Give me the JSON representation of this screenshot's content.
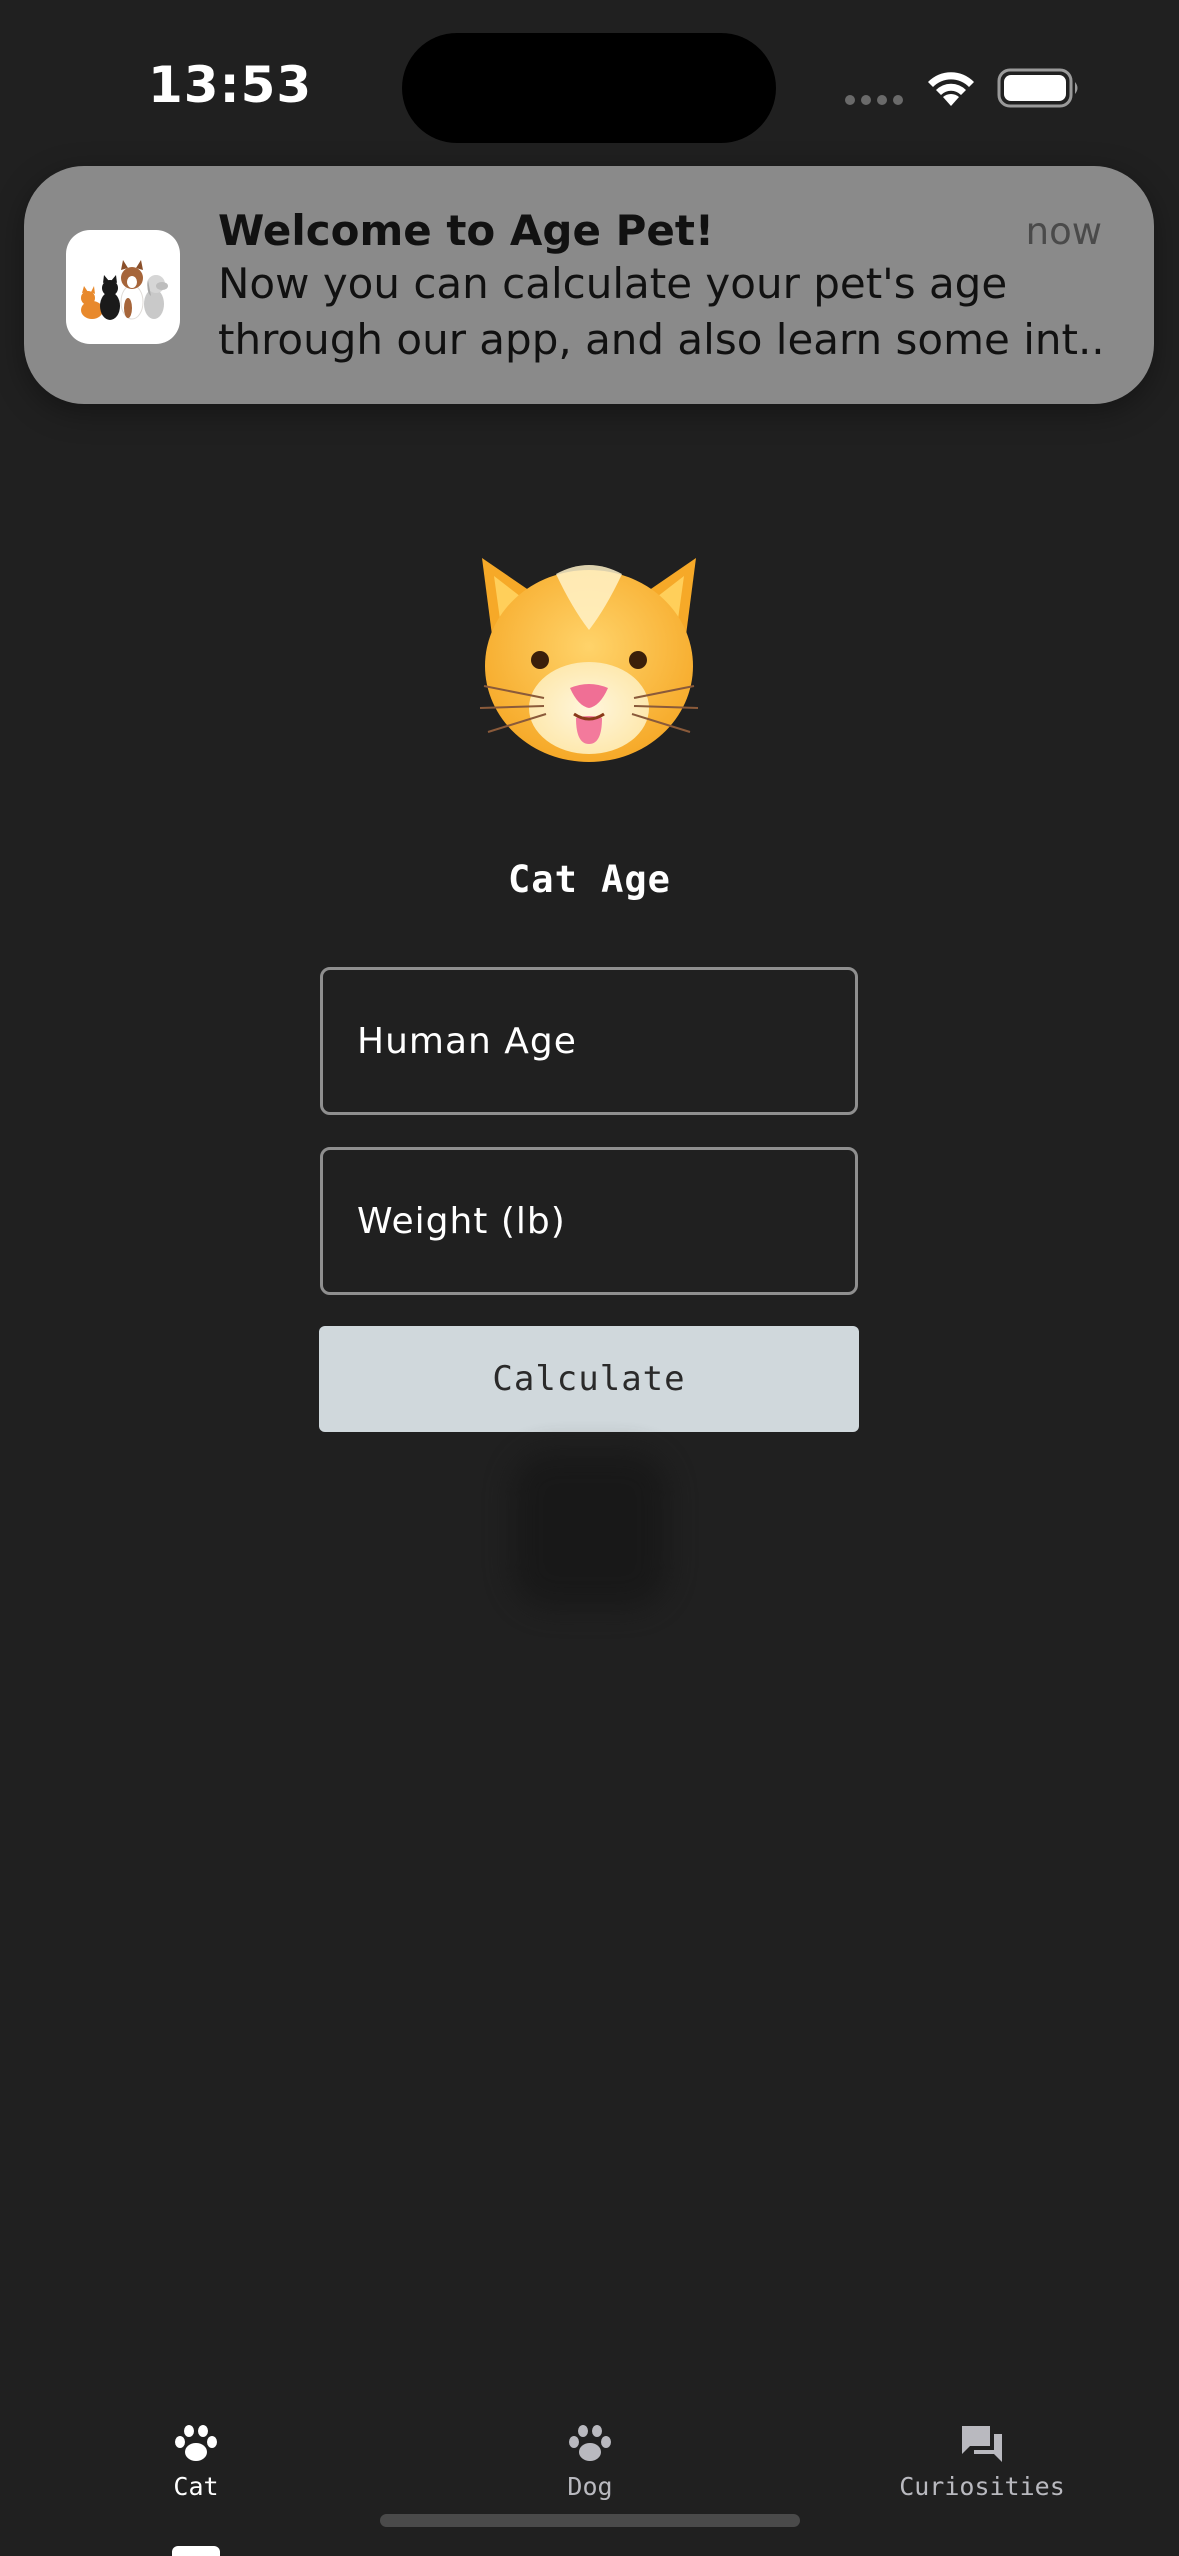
{
  "status_bar": {
    "time": "13:53"
  },
  "notification": {
    "app_icon": "pets-app-icon",
    "title": "Welcome to Age Pet!",
    "time": "now",
    "body_line1": "Now you can calculate your pet's age",
    "body_line2": "through our app, and also learn some int..."
  },
  "main": {
    "logo_icon": "cat-face-icon",
    "title": "Cat Age",
    "human_age_placeholder": "Human Age",
    "weight_placeholder": "Weight (lb)",
    "calculate_label": "Calculate"
  },
  "tabs": [
    {
      "label": "Cat",
      "icon": "paw-icon",
      "active": true
    },
    {
      "label": "Dog",
      "icon": "paw-icon",
      "active": false
    },
    {
      "label": "Curiosities",
      "icon": "chat-bubbles-icon",
      "active": false
    }
  ],
  "colors": {
    "background": "#202020",
    "notification_bg": "#8a8a8a",
    "button_bg": "#d0d8dc",
    "input_border": "#8f8f8f",
    "tab_active": "#ffffff",
    "tab_inactive": "#b9b9bf"
  }
}
